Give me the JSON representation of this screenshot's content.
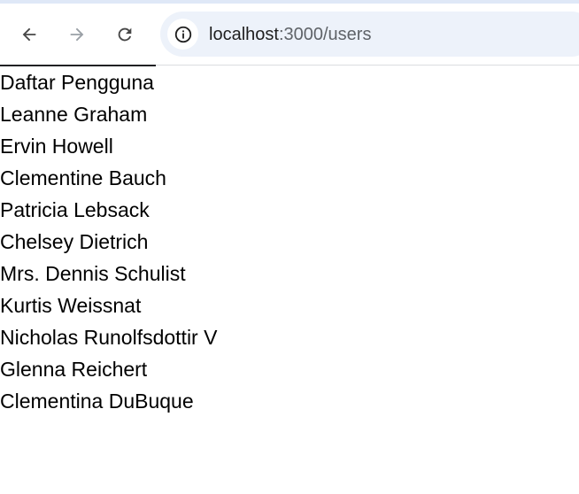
{
  "browser": {
    "url_host": "localhost",
    "url_path": ":3000/users"
  },
  "icons": {
    "back": "arrow-left-icon",
    "forward": "arrow-right-icon",
    "reload": "reload-icon",
    "site_info": "info-icon"
  },
  "colors": {
    "chrome_strip": "#dfe8f7",
    "omnibox_bg": "#edf2fa",
    "forward_disabled": "#9aa0a6"
  },
  "page": {
    "title": "Daftar Pengguna",
    "users": [
      "Leanne Graham",
      "Ervin Howell",
      "Clementine Bauch",
      "Patricia Lebsack",
      "Chelsey Dietrich",
      "Mrs. Dennis Schulist",
      "Kurtis Weissnat",
      "Nicholas Runolfsdottir V",
      "Glenna Reichert",
      "Clementina DuBuque"
    ]
  }
}
